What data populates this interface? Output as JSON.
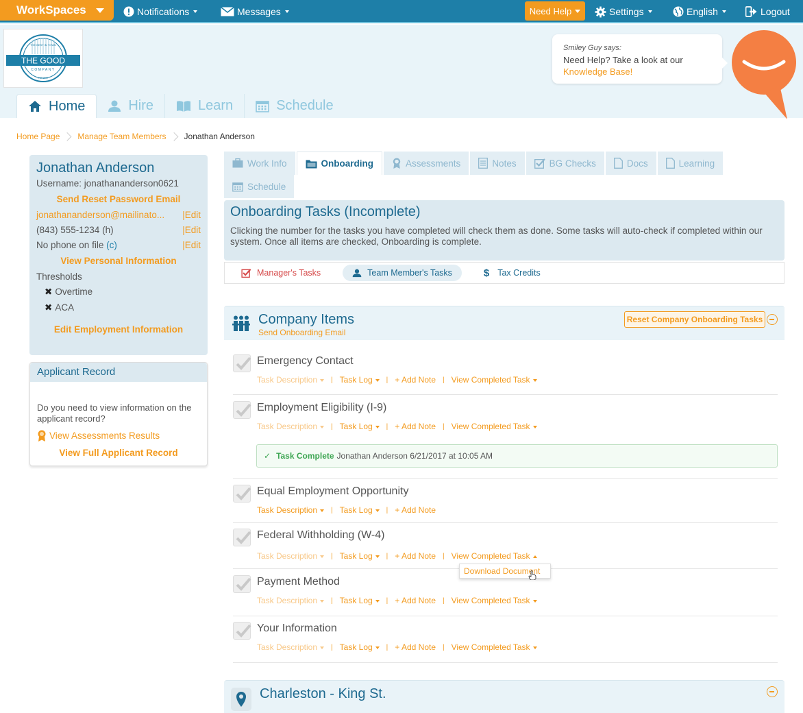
{
  "topbar": {
    "workspaces": "WorkSpaces",
    "notifications": "Notifications",
    "messages": "Messages",
    "need_help": "Need Help",
    "settings": "Settings",
    "language": "English",
    "logout": "Logout"
  },
  "logo": {
    "top_text": "THE BEST IN TOWN",
    "main": "THE GOOD",
    "sub": "COMPANY",
    "year": "EST 2017"
  },
  "helper": {
    "who": "Smiley Guy says:",
    "line1": "Need Help? Take a look at our",
    "link": "Knowledge Base!"
  },
  "main_tabs": [
    {
      "label": "Home"
    },
    {
      "label": "Hire"
    },
    {
      "label": "Learn"
    },
    {
      "label": "Schedule"
    }
  ],
  "breadcrumb": [
    "Home Page",
    "Manage Team Members",
    "Jonathan Anderson"
  ],
  "profile": {
    "name": "Jonathan Anderson",
    "username": "Username: jonathananderson0621",
    "reset": "Send Reset Password Email",
    "email": "jonathananderson@mailinato...",
    "phone": "(843) 555-1234 (h)",
    "no_phone": "No phone on file",
    "no_phone_c": "(c)",
    "edit": "|Edit",
    "view_personal": "View Personal Information",
    "thresholds": "Thresholds",
    "overtime": "Overtime",
    "aca": "ACA",
    "edit_employment": "Edit Employment Information"
  },
  "applicant": {
    "title": "Applicant Record",
    "question": "Do you need to view information on the applicant record?",
    "assessments": "View Assessments Results",
    "full": "View Full Applicant Record"
  },
  "section_tabs": [
    {
      "label": "Work Info"
    },
    {
      "label": "Onboarding"
    },
    {
      "label": "Assessments"
    },
    {
      "label": "Notes"
    },
    {
      "label": "BG Checks"
    },
    {
      "label": "Docs"
    },
    {
      "label": "Learning"
    },
    {
      "label": "Schedule"
    }
  ],
  "onboarding": {
    "title": "Onboarding Tasks (Incomplete)",
    "desc": "Clicking the number for the tasks you have completed will check them as done. Some tasks will auto-check if completed within our system. Once all items are checked, Onboarding is complete."
  },
  "subtabs": {
    "managers": "Manager's Tasks",
    "team": "Team Member's Tasks",
    "tax": "Tax Credits"
  },
  "company": {
    "title": "Company Items",
    "send": "Send Onboarding Email",
    "reset": "Reset Company Onboarding Tasks"
  },
  "task_links": {
    "desc": "Task Description",
    "log": "Task Log",
    "note": "+ Add Note",
    "view": "View Completed Task"
  },
  "tasks": [
    {
      "name": "Emergency Contact"
    },
    {
      "name": "Employment Eligibility (I-9)"
    },
    {
      "name": "Equal Employment Opportunity"
    },
    {
      "name": "Federal Withholding (W-4)"
    },
    {
      "name": "Payment Method"
    },
    {
      "name": "Your Information"
    }
  ],
  "complete_bar": {
    "label": "Task Complete",
    "info": "Jonathan Anderson 6/21/2017 at 10:05 AM"
  },
  "dropdown": {
    "download": "Download Document"
  },
  "location": {
    "title": "Charleston - King St."
  },
  "colors": {
    "brand_blue": "#1e7fa8",
    "accent_orange": "#f39b1f",
    "title_blue": "#1e6a90"
  }
}
